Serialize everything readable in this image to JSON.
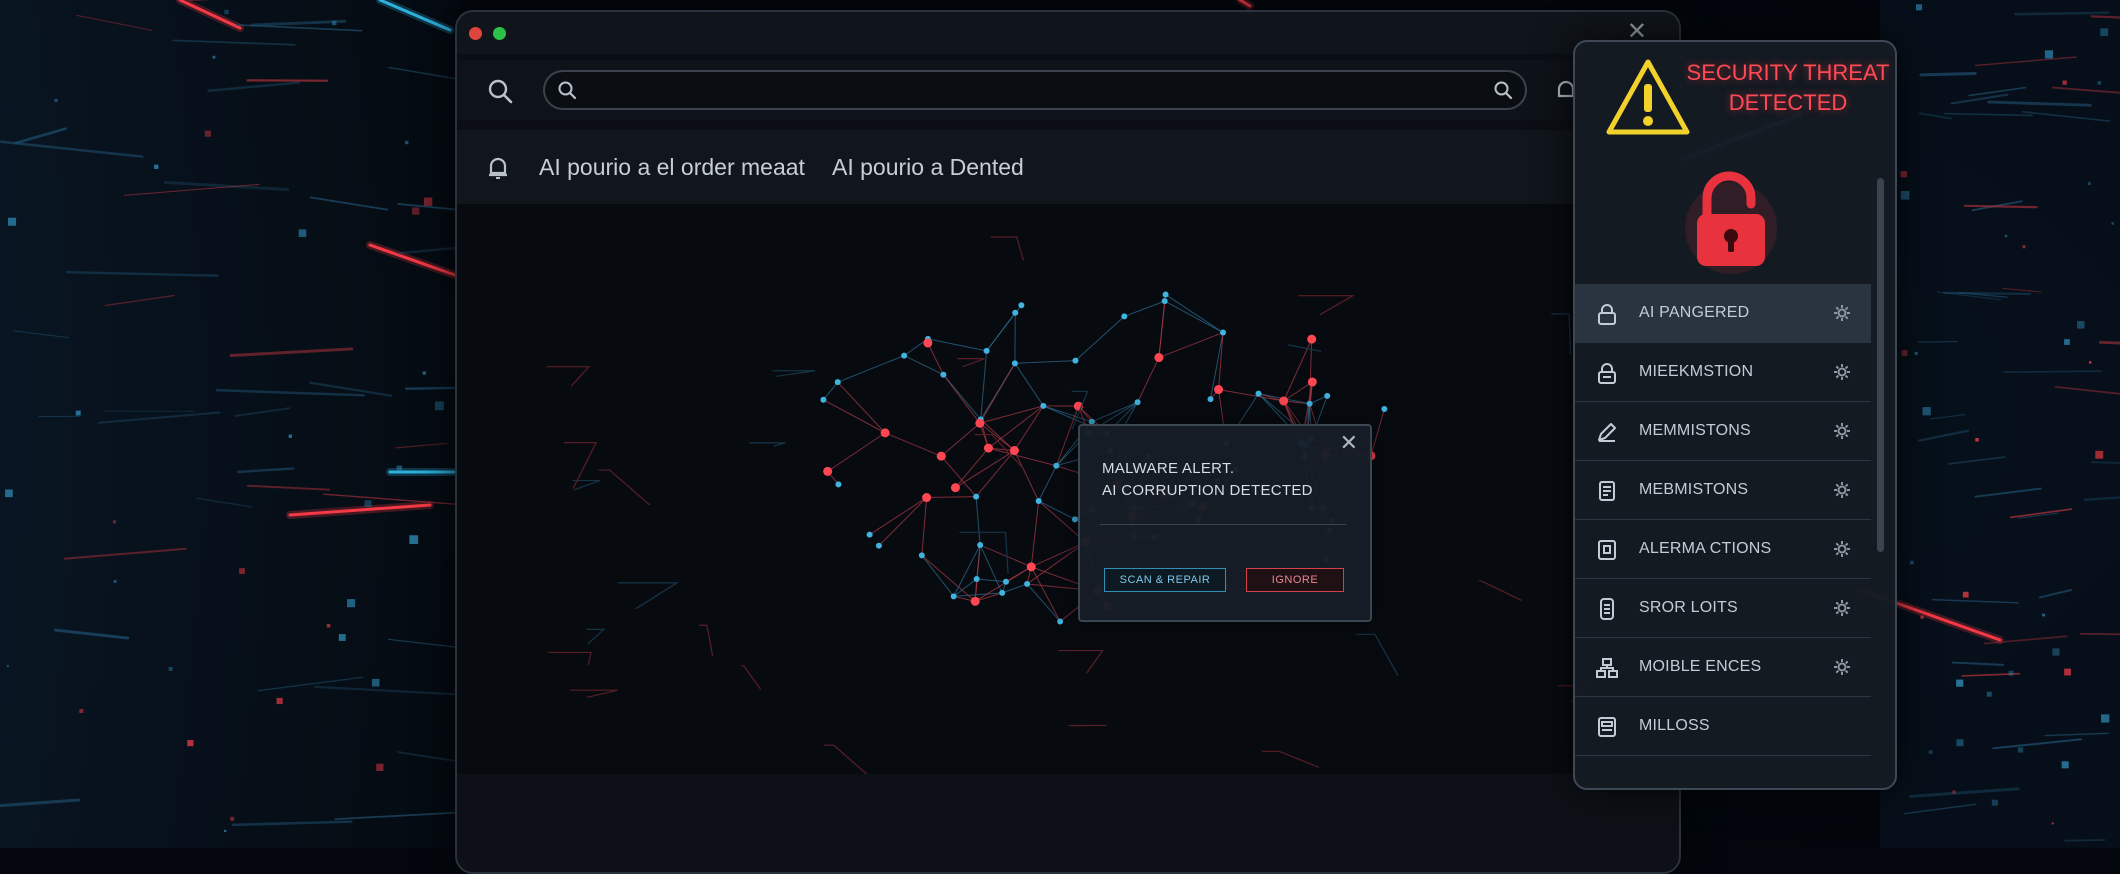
{
  "window": {
    "search": {
      "value": "",
      "placeholder": ""
    },
    "tabs": [
      {
        "label": "AI pourio a el order meaat"
      },
      {
        "label": "AI pourio a Dented"
      }
    ]
  },
  "dialog": {
    "title": "MALWARE ALERT.",
    "message": "AI CORRUPTION DETECTED",
    "scan_button": "SCAN & REPAIR",
    "ignore_button": "IGNORE"
  },
  "panel": {
    "threat_title_line1": "SECURITY THREAT",
    "threat_title_line2": "DETECTED",
    "items": [
      {
        "label": "AI PANGERED",
        "icon": "lock-icon"
      },
      {
        "label": "MIEEKMSTION",
        "icon": "lock-icon"
      },
      {
        "label": "MEMMISTONS",
        "icon": "pen-icon"
      },
      {
        "label": "MEBMISTONS",
        "icon": "document-icon"
      },
      {
        "label": "ALERMA CTIONS",
        "icon": "shield-icon"
      },
      {
        "label": "SROR LOITS",
        "icon": "document-icon"
      },
      {
        "label": "MOIBLE ENCES",
        "icon": "network-icon"
      },
      {
        "label": "MILLOSS",
        "icon": "document-icon"
      }
    ]
  },
  "colors": {
    "accent_red": "#ff4a55",
    "accent_cyan": "#2fb8e6",
    "warning_yellow": "#f2d22a",
    "background": "#03070d"
  }
}
